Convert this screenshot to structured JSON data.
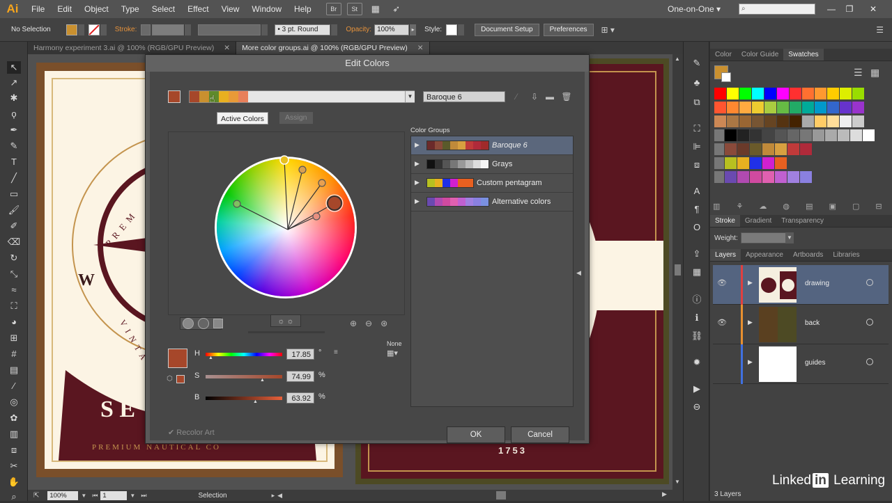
{
  "menubar": {
    "logo": "Ai",
    "items": [
      "File",
      "Edit",
      "Object",
      "Type",
      "Select",
      "Effect",
      "View",
      "Window",
      "Help"
    ],
    "bridge": "Br",
    "stock": "St",
    "workspace": "One-on-One"
  },
  "controlbar": {
    "selection": "No Selection",
    "stroke_label": "Stroke:",
    "stroke_style": "3 pt. Round",
    "opacity_label": "Opacity:",
    "opacity_value": "100%",
    "style_label": "Style:",
    "doc_setup": "Document Setup",
    "preferences": "Preferences"
  },
  "doctabs": [
    {
      "label": "Harmony experiment 3.ai @ 100% (RGB/GPU Preview)",
      "active": false
    },
    {
      "label": "More color groups.ai @ 100% (RGB/GPU Preview)",
      "active": true
    }
  ],
  "artwork": {
    "year": "1753",
    "letter_w": "W",
    "letters_se": "S E",
    "arc_top": "P R E M",
    "arc_side": "V I N T A",
    "arc_bottom": "PREMIUM NAUTICAL CO"
  },
  "statusbar": {
    "zoom": "100%",
    "page": "1",
    "tool": "Selection"
  },
  "dialog": {
    "title": "Edit Colors",
    "tooltip": "Active Colors",
    "tab_edit_hidden": "t",
    "tab_assign": "Assign",
    "group_name": "Baroque 6",
    "color_groups_label": "Color Groups",
    "hsb": {
      "h_label": "H",
      "h_value": "17.85",
      "h_unit": "°",
      "s_label": "S",
      "s_value": "74.99",
      "s_unit": "%",
      "b_label": "B",
      "b_value": "63.92",
      "b_unit": "%"
    },
    "none_label": "None",
    "recolor_art": "Recolor Art",
    "ok": "OK",
    "cancel": "Cancel",
    "active_colors": [
      "#a6472a",
      "#c9902f",
      "#5f8a2b",
      "#e8b020",
      "#e89a38",
      "#e8805a"
    ],
    "groups": [
      {
        "name": "Baroque 6",
        "colors": [
          "#6b2a2a",
          "#8a4a3a",
          "#5a5a2a",
          "#c08a3a",
          "#d8a040",
          "#c03a3a",
          "#b02a3a",
          "#a02a2a"
        ],
        "selected": true
      },
      {
        "name": "Grays",
        "colors": [
          "#111111",
          "#333333",
          "#555555",
          "#777777",
          "#999999",
          "#bbbbbb",
          "#dddddd",
          "#f5f5f5"
        ],
        "selected": false
      },
      {
        "name": "Custom pentagram",
        "colors": [
          "#b8c020",
          "#e8b020",
          "#2030e8",
          "#d020d0",
          "#e86020",
          "#e86020"
        ],
        "selected": false
      },
      {
        "name": "Alternative colors",
        "colors": [
          "#6a4ab0",
          "#b04ab0",
          "#d04aa0",
          "#e060b0",
          "#c060d0",
          "#a080e0",
          "#8a80e0",
          "#7a90e0"
        ],
        "selected": false
      }
    ]
  },
  "panels": {
    "swatch_tabs": [
      "Color",
      "Color Guide",
      "Swatches"
    ],
    "stroke_tabs": [
      "Stroke",
      "Gradient",
      "Transparency"
    ],
    "weight_label": "Weight:",
    "layer_tabs": [
      "Layers",
      "Appearance",
      "Artboards",
      "Libraries"
    ],
    "layers": [
      {
        "name": "drawing",
        "color": "#e04040",
        "selected": true,
        "thumb_bg": "#f5efe0"
      },
      {
        "name": "back",
        "color": "#e89030",
        "selected": false,
        "thumb_bg": "#5a4020"
      },
      {
        "name": "guides",
        "color": "#4070e0",
        "selected": false,
        "thumb_bg": "#ffffff"
      }
    ],
    "layer_count": "3 Layers",
    "swatch_rows": [
      [
        "#ff0000",
        "#ffff00",
        "#00ff00",
        "#00ffff",
        "#0000ff",
        "#ff00ff",
        "#ff3030",
        "#ff7030",
        "#ff9930",
        "#ffcc00",
        "#ddee00",
        "#99dd00"
      ],
      [
        "#ff5530",
        "#ff8830",
        "#ffaa40",
        "#eecc30",
        "#aacc40",
        "#66bb44",
        "#22aa66",
        "#00aa99",
        "#0099cc",
        "#3366cc",
        "#6633cc",
        "#9933cc"
      ],
      [
        "#cc8855",
        "#aa7744",
        "#996633",
        "#775533",
        "#664422",
        "#553311",
        "#442200",
        "#aaaaaa",
        "#ffcc66",
        "#ffdd99",
        "#eeeeee",
        "#cccccc"
      ],
      [
        "#000000",
        "#222222",
        "#333333",
        "#444444",
        "#555555",
        "#666666",
        "#777777",
        "#999999",
        "#aaaaaa",
        "#bbbbbb",
        "#dddddd",
        "#ffffff"
      ],
      [
        "#8a4a3a",
        "#6a3a2a",
        "#6a5a2a",
        "#c08a3a",
        "#d8a040",
        "#c03a3a",
        "#b02a3a"
      ],
      [
        "#b8c020",
        "#e8b020",
        "#2030e8",
        "#d020d0",
        "#e86020"
      ],
      [
        "#6a4ab0",
        "#b04ab0",
        "#d04aa0",
        "#e060b0",
        "#c060d0",
        "#a080e0",
        "#8a80e0"
      ]
    ]
  },
  "branding": {
    "linked": "Linked",
    "in": "in",
    "learning": "Learning"
  }
}
